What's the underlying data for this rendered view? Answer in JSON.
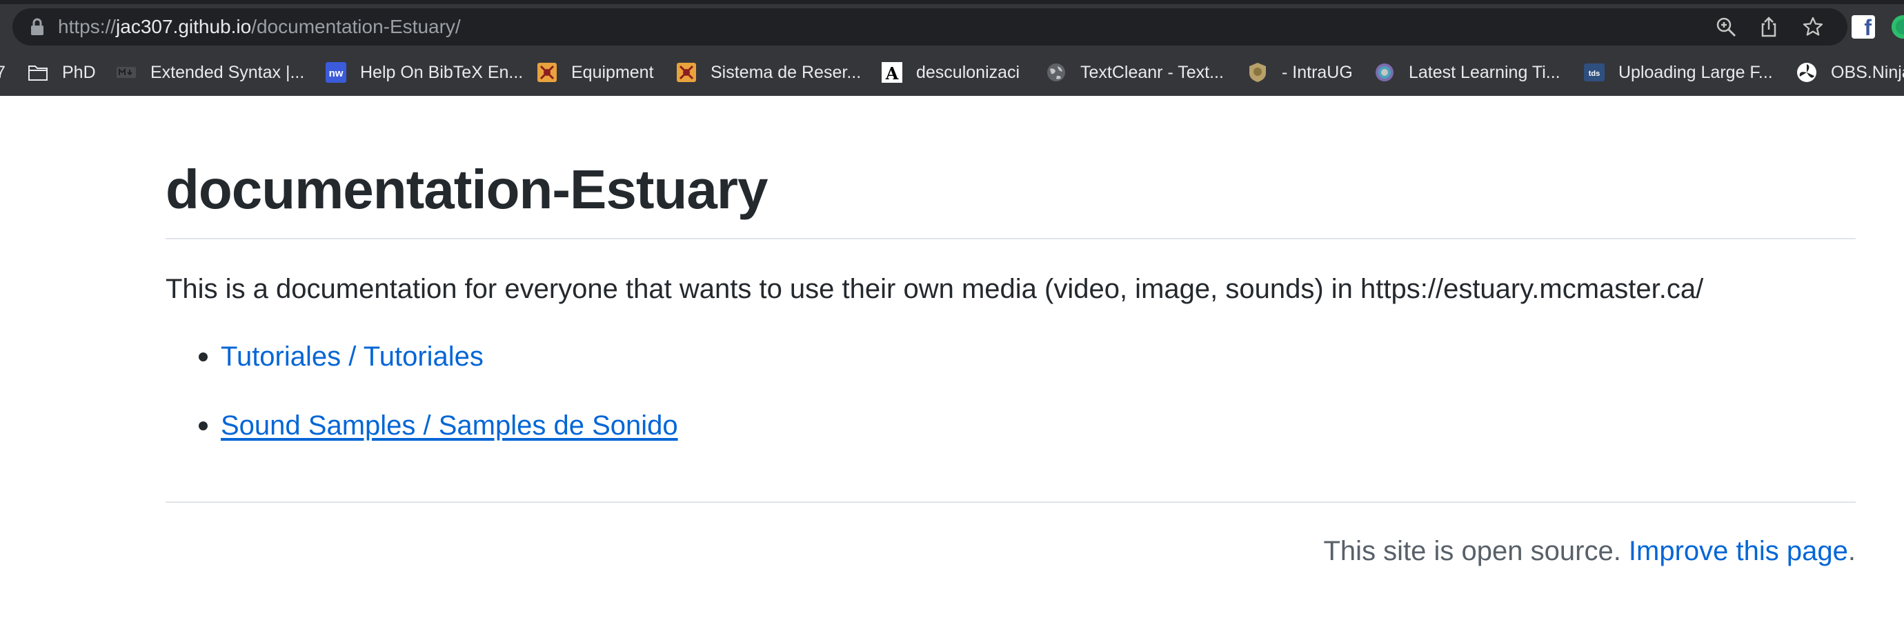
{
  "browser": {
    "url_prefix": "https://",
    "url_host": "jac307.github.io",
    "url_path": "/documentation-Estuary/",
    "bookmarks": [
      {
        "label": "7",
        "icon": "partial-bookmark-icon"
      },
      {
        "label": "PhD",
        "icon": "folder-icon"
      },
      {
        "label": "Extended Syntax |...",
        "icon": "markdown-icon"
      },
      {
        "label": "Help On BibTeX En...",
        "icon": "nw-logo-icon"
      },
      {
        "label": "Equipment",
        "icon": "crest-icon"
      },
      {
        "label": "Sistema de Reser...",
        "icon": "crest-icon"
      },
      {
        "label": "desculonizaci",
        "icon": "letter-a-icon"
      },
      {
        "label": "TextCleanr - Text...",
        "icon": "globe-icon"
      },
      {
        "label": "- IntraUG",
        "icon": "seal-icon"
      },
      {
        "label": "Latest Learning Ti...",
        "icon": "target-icon"
      },
      {
        "label": "Uploading Large F...",
        "icon": "tds-icon"
      },
      {
        "label": "OBS.Ninja",
        "icon": "ninja-icon"
      }
    ]
  },
  "page": {
    "title": "documentation-Estuary",
    "description": "This is a documentation for everyone that wants to use their own media (video, image, sounds) in https://estuary.mcmaster.ca/",
    "links": [
      {
        "label": "Tutoriales / Tutoriales"
      },
      {
        "label": "Sound Samples / Samples de Sonido"
      }
    ],
    "footer_text": "This site is open source. ",
    "footer_link": "Improve this page",
    "footer_end": "."
  },
  "colors": {
    "link": "#0366d6",
    "text": "#24292e",
    "chrome_bg": "#35363a"
  }
}
